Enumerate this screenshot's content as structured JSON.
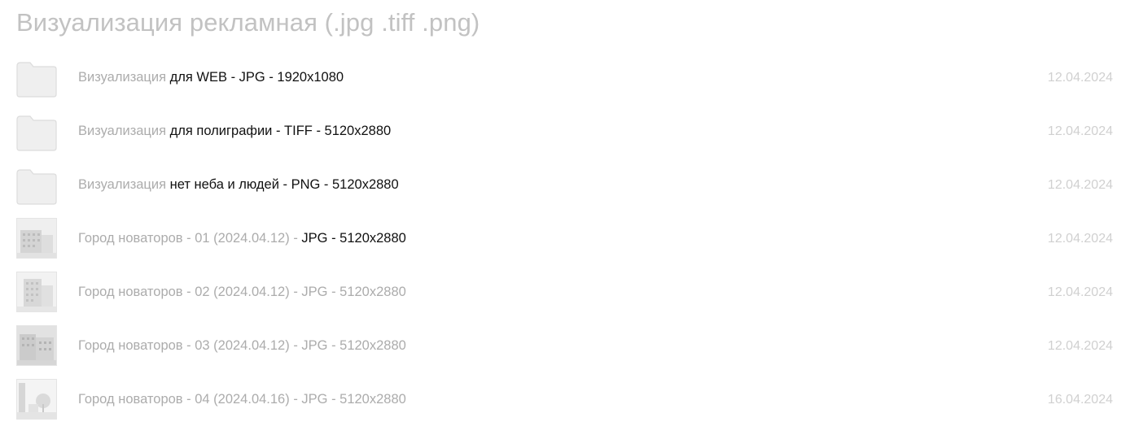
{
  "page": {
    "title": "Визуализация рекламная (.jpg .tiff .png)"
  },
  "items": [
    {
      "type": "folder",
      "icon": "folder-icon",
      "name_muted": "Визуализация",
      "name_dark": " для WEB - JPG - 1920x1080",
      "date": "12.04.2024"
    },
    {
      "type": "folder",
      "icon": "folder-icon",
      "name_muted": "Визуализация",
      "name_dark": " для полиграфии - TIFF - 5120x2880",
      "date": "12.04.2024"
    },
    {
      "type": "folder",
      "icon": "folder-icon",
      "name_muted": "Визуализация",
      "name_dark": " нет неба и людей - PNG - 5120x2880",
      "date": "12.04.2024"
    },
    {
      "type": "image",
      "icon": "image-thumbnail",
      "name_muted": "Город новаторов - 01 (2024.04.12) - ",
      "name_dark": "JPG - 5120x2880",
      "date": "12.04.2024"
    },
    {
      "type": "image",
      "icon": "image-thumbnail",
      "name_muted": "Город новаторов - 02 (2024.04.12) - JPG - 5120x2880",
      "name_dark": "",
      "date": "12.04.2024"
    },
    {
      "type": "image",
      "icon": "image-thumbnail",
      "name_muted": "Город новаторов - 03 (2024.04.12) - JPG - 5120x2880",
      "name_dark": "",
      "date": "12.04.2024"
    },
    {
      "type": "image",
      "icon": "image-thumbnail",
      "name_muted": "Город новаторов - 04 (2024.04.16) - JPG - 5120x2880",
      "name_dark": "",
      "date": "16.04.2024"
    }
  ],
  "colors": {
    "title": "#c2c2c2",
    "muted_text": "#acacac",
    "dark_text": "#111111",
    "date": "#d0d0d0",
    "folder_fill": "#efefef",
    "folder_stroke": "#dcdcdc"
  }
}
